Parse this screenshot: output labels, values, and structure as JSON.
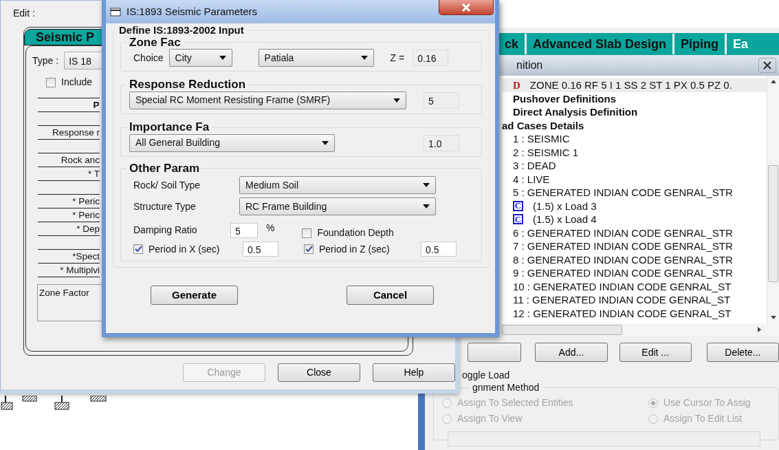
{
  "edit_window": {
    "title": "Edit :",
    "tab": {
      "label": "Seismic P",
      "selected": true
    },
    "type_label": "Type :",
    "type_value": "IS 18",
    "include": {
      "label": "Include",
      "checked": false
    },
    "table_rows": [
      {
        "kind": "header",
        "text": "P"
      },
      {
        "kind": "blank"
      },
      {
        "kind": "text",
        "text": "Response r"
      },
      {
        "kind": "blank"
      },
      {
        "kind": "text",
        "text": "Rock anc"
      },
      {
        "kind": "text",
        "text": "* T"
      },
      {
        "kind": "blank"
      },
      {
        "kind": "text",
        "text": "* Peric"
      },
      {
        "kind": "text",
        "text": "* Peric"
      },
      {
        "kind": "text",
        "text": "* Dep"
      },
      {
        "kind": "blank"
      },
      {
        "kind": "text",
        "text": "*Spect"
      },
      {
        "kind": "text",
        "text": "* Multiplvi"
      }
    ],
    "description": "Zone Factor",
    "buttons": [
      {
        "label": "Change",
        "disabled": true
      },
      {
        "label": "Close",
        "disabled": false
      },
      {
        "label": "Help",
        "disabled": false
      }
    ]
  },
  "dialog": {
    "title": "IS:1893 Seismic Parameters",
    "group_title": "Define IS:1893-2002 Input",
    "zone": {
      "legend": "Zone Fac",
      "choice_label": "Choice",
      "choice": "City",
      "city": "Patiala",
      "z_label": "Z =",
      "z_value": "0.16"
    },
    "response": {
      "legend": "Response Reduction",
      "frame": "Special RC Moment Resisting Frame (SMRF)",
      "value": "5"
    },
    "importance": {
      "legend": "Importance Fa",
      "building": "All General Building",
      "value": "1.0"
    },
    "other": {
      "legend": "Other Param",
      "soil_label": "Rock/ Soil Type",
      "soil": "Medium Soil",
      "structure_label": "Structure Type",
      "structure": "RC Frame Building",
      "damping_label": "Damping Ratio",
      "damping": "5",
      "damping_unit": "%",
      "foundation": {
        "label": "Foundation Depth",
        "checked": false
      },
      "period_x": {
        "label": "Period in X (sec)",
        "checked": true,
        "value": "0.5"
      },
      "period_z": {
        "label": "Period in Z (sec)",
        "checked": true,
        "value": "0.5"
      }
    },
    "buttons": [
      "Generate",
      "Cancel"
    ]
  },
  "load_page": {
    "tabs": [
      {
        "label": "ck",
        "selected": false
      },
      {
        "label": "Advanced Slab Design",
        "selected": false
      },
      {
        "label": "Piping",
        "selected": false
      },
      {
        "label": "Ea",
        "selected": true
      }
    ],
    "panel_title": "nition",
    "tree": [
      {
        "kind": "definition",
        "marker": "D",
        "text": "ZONE 0.16 RF 5 I 1 SS 2 ST 1 PX 0.5 PZ 0.",
        "selected": true
      },
      {
        "kind": "heading",
        "text": "Pushover Definitions",
        "selected": false
      },
      {
        "kind": "heading",
        "text": "Direct Analysis Definition",
        "selected": false
      },
      {
        "kind": "heading",
        "text": "ad Cases Details",
        "selected": false,
        "children": [
          {
            "kind": "load",
            "text": "1 : SEISMIC",
            "selected": false
          },
          {
            "kind": "load",
            "text": "2 : SEISMIC 1",
            "selected": false
          },
          {
            "kind": "load",
            "text": "3 : DEAD",
            "selected": false
          },
          {
            "kind": "load",
            "text": "4 : LIVE",
            "selected": false
          },
          {
            "kind": "load",
            "text": "5 : GENERATED INDIAN CODE GENRAL_STR",
            "selected": false,
            "children": [
              {
                "kind": "combination",
                "marker": "C",
                "text": "(1.5) x Load 3",
                "selected": false
              },
              {
                "kind": "combination",
                "marker": "C",
                "text": "(1.5) x Load 4",
                "selected": false
              }
            ]
          },
          {
            "kind": "load",
            "text": "6 : GENERATED INDIAN CODE GENRAL_STR",
            "selected": false
          },
          {
            "kind": "load",
            "text": "7 : GENERATED INDIAN CODE GENRAL_STR",
            "selected": false
          },
          {
            "kind": "load",
            "text": "8 : GENERATED INDIAN CODE GENRAL_STR",
            "selected": false
          },
          {
            "kind": "load",
            "text": "9 : GENERATED INDIAN CODE GENRAL_STR",
            "selected": false
          },
          {
            "kind": "load",
            "text": "10 : GENERATED INDIAN CODE GENRAL_ST",
            "selected": false
          },
          {
            "kind": "load",
            "text": "11 : GENERATED INDIAN CODE GENRAL_ST",
            "selected": false
          },
          {
            "kind": "load",
            "text": "12 : GENERATED INDIAN CODE GENRAL_ST",
            "selected": false
          }
        ]
      }
    ],
    "buttons": [
      "Add...",
      "Edit ...",
      "Delete..."
    ],
    "toggle_label": "oggle Load",
    "method_legend": "gnment Method",
    "methods_disabled": true,
    "methods": [
      {
        "label": "Assign To Selected Entities",
        "selected": false
      },
      {
        "label": "Use Cursor To Assig",
        "selected": true
      },
      {
        "label": "Assign To View",
        "selected": false
      },
      {
        "label": "Assign To Edit List",
        "selected": false
      }
    ]
  }
}
